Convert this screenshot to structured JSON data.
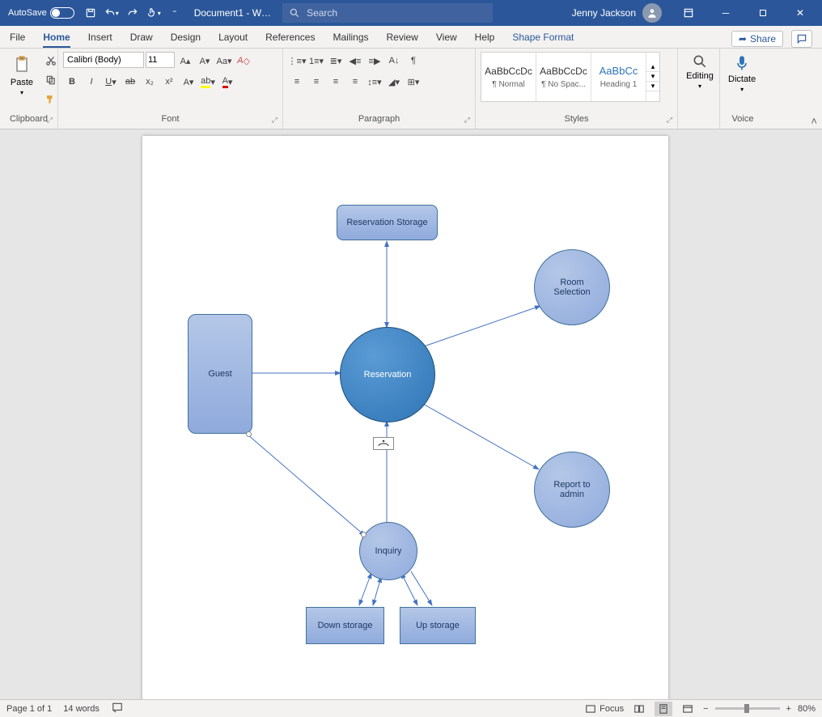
{
  "titlebar": {
    "autosave": "AutoSave",
    "doc_title": "Document1 - W…",
    "search_placeholder": "Search",
    "user_name": "Jenny Jackson"
  },
  "tabs": {
    "file": "File",
    "home": "Home",
    "insert": "Insert",
    "draw": "Draw",
    "design": "Design",
    "layout": "Layout",
    "references": "References",
    "mailings": "Mailings",
    "review": "Review",
    "view": "View",
    "help": "Help",
    "shape_format": "Shape Format",
    "share": "Share"
  },
  "ribbon": {
    "clipboard_label": "Clipboard",
    "paste": "Paste",
    "font_label": "Font",
    "font_name": "Calibri (Body)",
    "font_size": "11",
    "paragraph_label": "Paragraph",
    "styles_label": "Styles",
    "style1_sample": "AaBbCcDc",
    "style1_name": "¶ Normal",
    "style2_sample": "AaBbCcDc",
    "style2_name": "¶ No Spac...",
    "style3_sample": "AaBbCc",
    "style3_name": "Heading 1",
    "editing": "Editing",
    "dictate": "Dictate",
    "voice_label": "Voice"
  },
  "shapes": {
    "reservation_storage": "Reservation Storage",
    "room_selection": "Room\nSelection",
    "guest": "Guest",
    "reservation": "Reservation",
    "report_admin": "Report to\nadmin",
    "inquiry": "Inquiry",
    "down_storage": "Down storage",
    "up_storage": "Up storage"
  },
  "statusbar": {
    "page": "Page 1 of 1",
    "words": "14 words",
    "focus": "Focus",
    "zoom": "80%"
  }
}
